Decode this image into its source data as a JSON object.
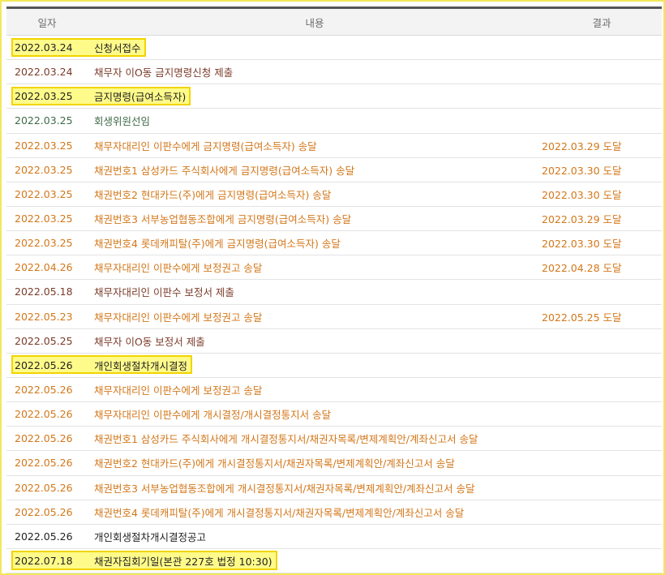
{
  "headers": {
    "date": "일자",
    "content": "내용",
    "result": "결과"
  },
  "colors": {
    "black": "#222222",
    "brown": "#7b3b2a",
    "green": "#3e6b48",
    "orange": "#d3771a",
    "highlight_fill": "#fffb8a",
    "highlight_border": "#f1d400"
  },
  "rows": [
    {
      "date": "2022.03.24",
      "content": "신청서접수",
      "result": "",
      "color": "#222222",
      "highlight": true
    },
    {
      "date": "2022.03.24",
      "content": "채무자 이O동 금지명령신청 제출",
      "result": "",
      "color": "#7b3b2a",
      "highlight": false
    },
    {
      "date": "2022.03.25",
      "content": "금지명령(급여소득자)",
      "result": "",
      "color": "#222222",
      "highlight": true
    },
    {
      "date": "2022.03.25",
      "content": "회생위원선임",
      "result": "",
      "color": "#3e6b48",
      "highlight": false
    },
    {
      "date": "2022.03.25",
      "content": "채무자대리인 이판수에게 금지명령(급여소득자) 송달",
      "result": "2022.03.29 도달",
      "color": "#d3771a",
      "highlight": false
    },
    {
      "date": "2022.03.25",
      "content": "채권번호1 삼성카드 주식회사에게 금지명령(급여소득자) 송달",
      "result": "2022.03.30 도달",
      "color": "#d3771a",
      "highlight": false
    },
    {
      "date": "2022.03.25",
      "content": "채권번호2 현대카드(주)에게 금지명령(급여소득자) 송달",
      "result": "2022.03.30 도달",
      "color": "#d3771a",
      "highlight": false
    },
    {
      "date": "2022.03.25",
      "content": "채권번호3 서부농업협동조합에게 금지명령(급여소득자) 송달",
      "result": "2022.03.29 도달",
      "color": "#d3771a",
      "highlight": false
    },
    {
      "date": "2022.03.25",
      "content": "채권번호4 롯데캐피탈(주)에게 금지명령(급여소득자) 송달",
      "result": "2022.03.30 도달",
      "color": "#d3771a",
      "highlight": false
    },
    {
      "date": "2022.04.26",
      "content": "채무자대리인 이판수에게 보정권고 송달",
      "result": "2022.04.28 도달",
      "color": "#d3771a",
      "highlight": false
    },
    {
      "date": "2022.05.18",
      "content": "채무자대리인 이판수 보정서 제출",
      "result": "",
      "color": "#7b3b2a",
      "highlight": false
    },
    {
      "date": "2022.05.23",
      "content": "채무자대리인 이판수에게 보정권고 송달",
      "result": "2022.05.25 도달",
      "color": "#d3771a",
      "highlight": false
    },
    {
      "date": "2022.05.25",
      "content": "채무자 이O동 보정서 제출",
      "result": "",
      "color": "#7b3b2a",
      "highlight": false
    },
    {
      "date": "2022.05.26",
      "content": "개인회생절차개시결정",
      "result": "",
      "color": "#222222",
      "highlight": true
    },
    {
      "date": "2022.05.26",
      "content": "채무자대리인 이판수에게 보정권고 송달",
      "result": "",
      "color": "#d3771a",
      "highlight": false
    },
    {
      "date": "2022.05.26",
      "content": "채무자대리인 이판수에게 개시결정/개시결정통지서 송달",
      "result": "",
      "color": "#d3771a",
      "highlight": false
    },
    {
      "date": "2022.05.26",
      "content": "채권번호1 삼성카드 주식회사에게 개시결정통지서/채권자목록/변제계획안/계좌신고서 송달",
      "result": "",
      "color": "#d3771a",
      "highlight": false
    },
    {
      "date": "2022.05.26",
      "content": "채권번호2 현대카드(주)에게 개시결정통지서/채권자목록/변제계획안/계좌신고서 송달",
      "result": "",
      "color": "#d3771a",
      "highlight": false
    },
    {
      "date": "2022.05.26",
      "content": "채권번호3 서부농업협동조합에게 개시결정통지서/채권자목록/변제계획안/계좌신고서 송달",
      "result": "",
      "color": "#d3771a",
      "highlight": false
    },
    {
      "date": "2022.05.26",
      "content": "채권번호4 롯데캐피탈(주)에게 개시결정통지서/채권자목록/변제계획안/계좌신고서 송달",
      "result": "",
      "color": "#d3771a",
      "highlight": false
    },
    {
      "date": "2022.05.26",
      "content": "개인회생절차개시결정공고",
      "result": "",
      "color": "#222222",
      "highlight": false
    },
    {
      "date": "2022.07.18",
      "content": "채권자집회기일(본관 227호 법정 10:30)",
      "result": "",
      "color": "#222222",
      "highlight": true
    }
  ]
}
